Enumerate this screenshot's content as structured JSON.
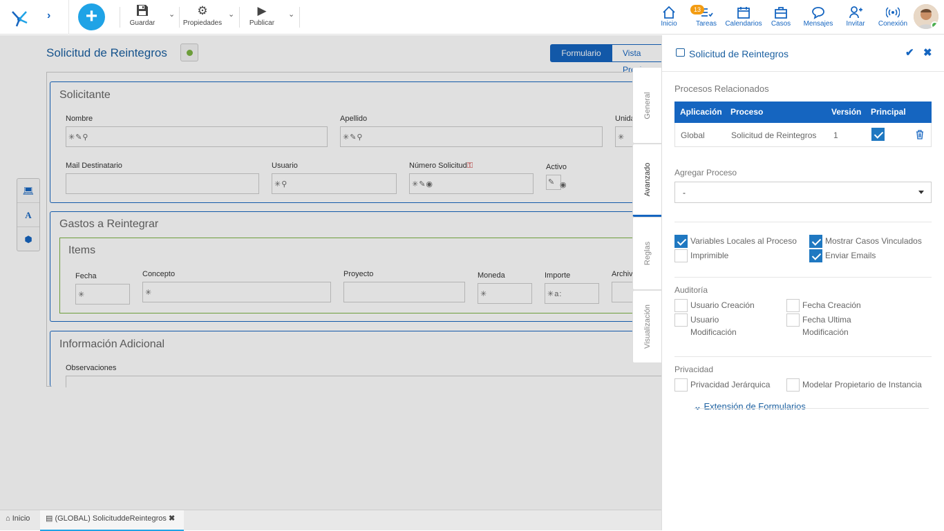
{
  "toolbar": {
    "save_label": "Guardar",
    "properties_label": "Propiedades",
    "publish_label": "Publicar"
  },
  "nav": {
    "home": "Inicio",
    "tasks": "Tareas",
    "tasks_badge": "13",
    "calendars": "Calendarios",
    "cases": "Casos",
    "messages": "Mensajes",
    "invite": "Invitar",
    "connection": "Conexión"
  },
  "form": {
    "title": "Solicitud de Reintegros",
    "view_tabs": [
      "Formulario",
      "Vista Previ"
    ],
    "sections": {
      "solicitante": "Solicitante",
      "gastos": "Gastos a Reintegrar",
      "items": "Items",
      "info": "Información Adicional"
    },
    "fields": {
      "nombre": "Nombre",
      "apellido": "Apellido",
      "unidad": "Unida",
      "mail": "Mail Destinatario",
      "usuario": "Usuario",
      "numero": "Número Solicitud",
      "activo": "Activo",
      "fecha": "Fecha",
      "concepto": "Concepto",
      "proyecto": "Proyecto",
      "moneda": "Moneda",
      "importe": "Importe",
      "archivo": "Archiv",
      "observaciones": "Observaciones"
    }
  },
  "vtabs": [
    "General",
    "Avanzado",
    "Reglas",
    "Visualización"
  ],
  "panel": {
    "title": "Solicitud de Reintegros",
    "procesos_label": "Procesos Relacionados",
    "table_headers": [
      "Aplicación",
      "Proceso",
      "Versión",
      "Principal"
    ],
    "table_rows": [
      {
        "app": "Global",
        "proceso": "Solicitud de Reintegros",
        "version": "1"
      }
    ],
    "agregar_label": "Agregar Proceso",
    "agregar_value": "-",
    "options": {
      "variables_locales": "Variables Locales al Proceso",
      "mostrar_casos": "Mostrar Casos Vinculados",
      "imprimible": "Imprimible",
      "enviar_emails": "Enviar Emails"
    },
    "auditoria_label": "Auditoría",
    "auditoria": {
      "usuario_creacion": "Usuario Creación",
      "fecha_creacion": "Fecha Creación",
      "usuario_mod_1": "Usuario",
      "usuario_mod_2": "Modificación",
      "fecha_mod_1": "Fecha Ultima",
      "fecha_mod_2": "Modificación"
    },
    "privacidad_label": "Privacidad",
    "privacidad": {
      "jerarquica": "Privacidad Jerárquica",
      "propietario": "Modelar Propietario de Instancia"
    },
    "extension_label": "Extensión de Formularios"
  },
  "bottom_tabs": {
    "home": "Inicio",
    "form_tab": "(GLOBAL) SolicituddeReintegros"
  }
}
